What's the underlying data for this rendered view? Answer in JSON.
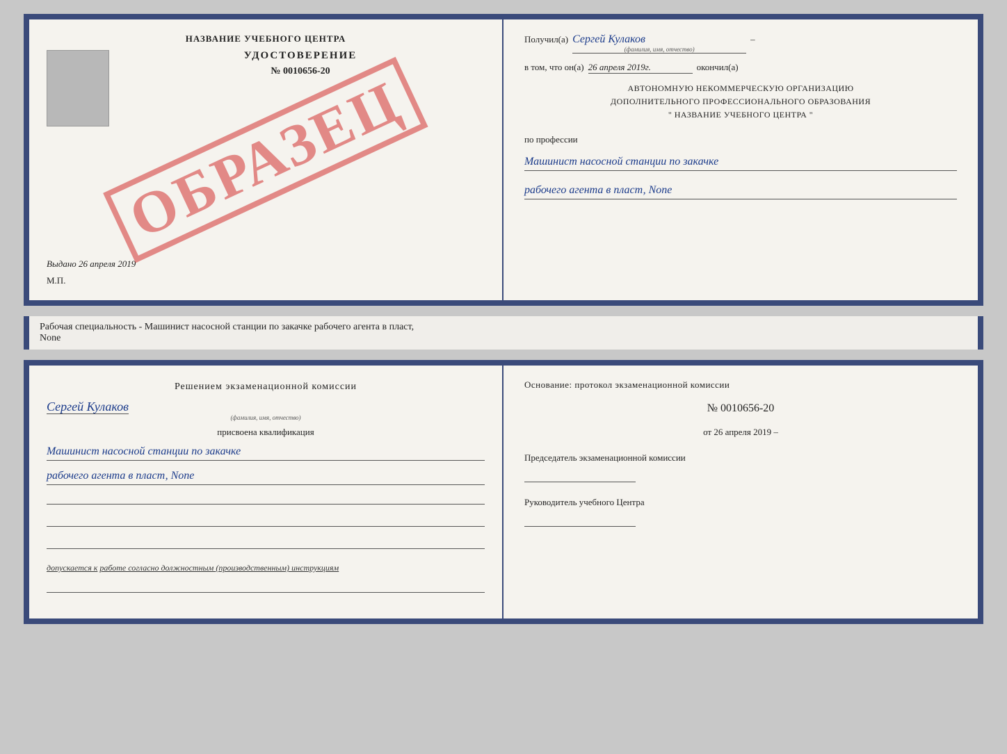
{
  "doc_top": {
    "left": {
      "title": "НАЗВАНИЕ УЧЕБНОГО ЦЕНТРА",
      "stamp_text": "ОБРАЗЕЦ",
      "cert_label": "УДОСТОВЕРЕНИЕ",
      "cert_number": "№ 0010656-20",
      "issued_label": "Выдано",
      "issued_date": "26 апреля 2019",
      "mp_label": "М.П."
    },
    "right": {
      "recipient_prefix": "Получил(а)",
      "recipient_name": "Сергей Кулаков",
      "recipient_hint": "(фамилия, имя, отчество)",
      "date_prefix": "в том, что он(а)",
      "date_value": "26 апреля 2019г.",
      "date_suffix": "окончил(а)",
      "org_line1": "АВТОНОМНУЮ НЕКОММЕРЧЕСКУЮ ОРГАНИЗАЦИЮ",
      "org_line2": "ДОПОЛНИТЕЛЬНОГО ПРОФЕССИОНАЛЬНОГО ОБРАЗОВАНИЯ",
      "org_line3": "\"    НАЗВАНИЕ УЧЕБНОГО ЦЕНТРА    \"",
      "profession_prefix": "по профессии",
      "profession_line1": "Машинист насосной станции по закачке",
      "profession_line2": "рабочего агента в пласт, None"
    }
  },
  "separator": {
    "text": "Рабочая специальность - Машинист насосной станции по закачке рабочего агента в пласт,",
    "text2": "None"
  },
  "doc_bottom": {
    "left": {
      "decision_text": "Решением  экзаменационной  комиссии",
      "person_name": "Сергей Кулаков",
      "person_hint": "(фамилия, имя, отчество)",
      "assigned_label": "присвоена квалификация",
      "qualification_line1": "Машинист насосной станции по закачке",
      "qualification_line2": "рабочего агента в пласт, None",
      "allowed_prefix": "допускается к",
      "allowed_work": "работе согласно должностным (производственным) инструкциям"
    },
    "right": {
      "basis_text": "Основание: протокол экзаменационной  комиссии",
      "protocol_number": "№  0010656-20",
      "protocol_date_prefix": "от",
      "protocol_date": "26 апреля 2019",
      "chairman_label": "Председатель экзаменационной комиссии",
      "director_label": "Руководитель учебного Центра"
    }
  }
}
